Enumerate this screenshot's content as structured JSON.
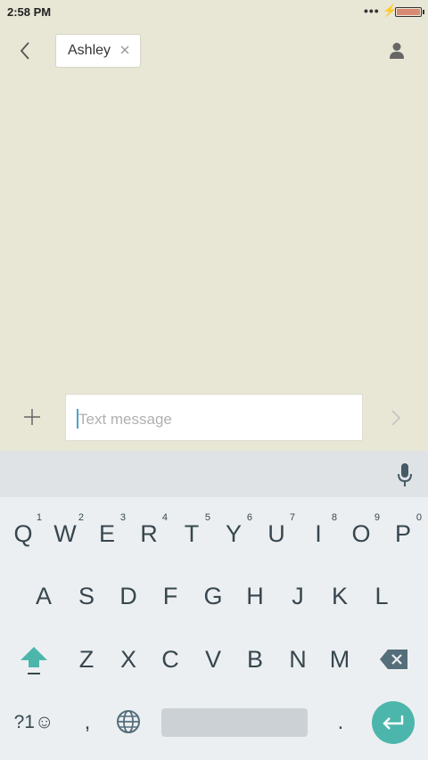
{
  "status_bar": {
    "time": "2:58 PM",
    "overflow_dots": "•••",
    "charging_symbol": "⚡"
  },
  "header": {
    "recipient_chip": {
      "label": "Ashley",
      "remove_icon": "close-icon"
    },
    "back_icon": "chevron-left-icon",
    "contact_icon": "person-icon"
  },
  "composer": {
    "placeholder": "Text message",
    "value": "",
    "add_icon": "plus-icon",
    "send_icon": "chevron-right-icon"
  },
  "keyboard": {
    "mic_icon": "microphone-icon",
    "rows": [
      [
        {
          "label": "Q",
          "hint": "1"
        },
        {
          "label": "W",
          "hint": "2"
        },
        {
          "label": "E",
          "hint": "3"
        },
        {
          "label": "R",
          "hint": "4"
        },
        {
          "label": "T",
          "hint": "5"
        },
        {
          "label": "Y",
          "hint": "6"
        },
        {
          "label": "U",
          "hint": "7"
        },
        {
          "label": "I",
          "hint": "8"
        },
        {
          "label": "O",
          "hint": "9"
        },
        {
          "label": "P",
          "hint": "0"
        }
      ],
      [
        {
          "label": "A"
        },
        {
          "label": "S"
        },
        {
          "label": "D"
        },
        {
          "label": "F"
        },
        {
          "label": "G"
        },
        {
          "label": "H"
        },
        {
          "label": "J"
        },
        {
          "label": "K"
        },
        {
          "label": "L"
        }
      ],
      [
        {
          "label": "Z"
        },
        {
          "label": "X"
        },
        {
          "label": "C"
        },
        {
          "label": "V"
        },
        {
          "label": "B"
        },
        {
          "label": "N"
        },
        {
          "label": "M"
        }
      ]
    ],
    "symbols_label": "?1☺",
    "comma_label": ",",
    "period_label": ".",
    "shift_icon": "shift-icon",
    "delete_icon": "backspace-icon",
    "globe_icon": "globe-icon",
    "enter_icon": "enter-icon",
    "colors": {
      "accent": "#4db6ac",
      "key_text": "#37474f"
    }
  },
  "colors": {
    "background": "#e8e6d5",
    "battery": "#d98a72"
  }
}
